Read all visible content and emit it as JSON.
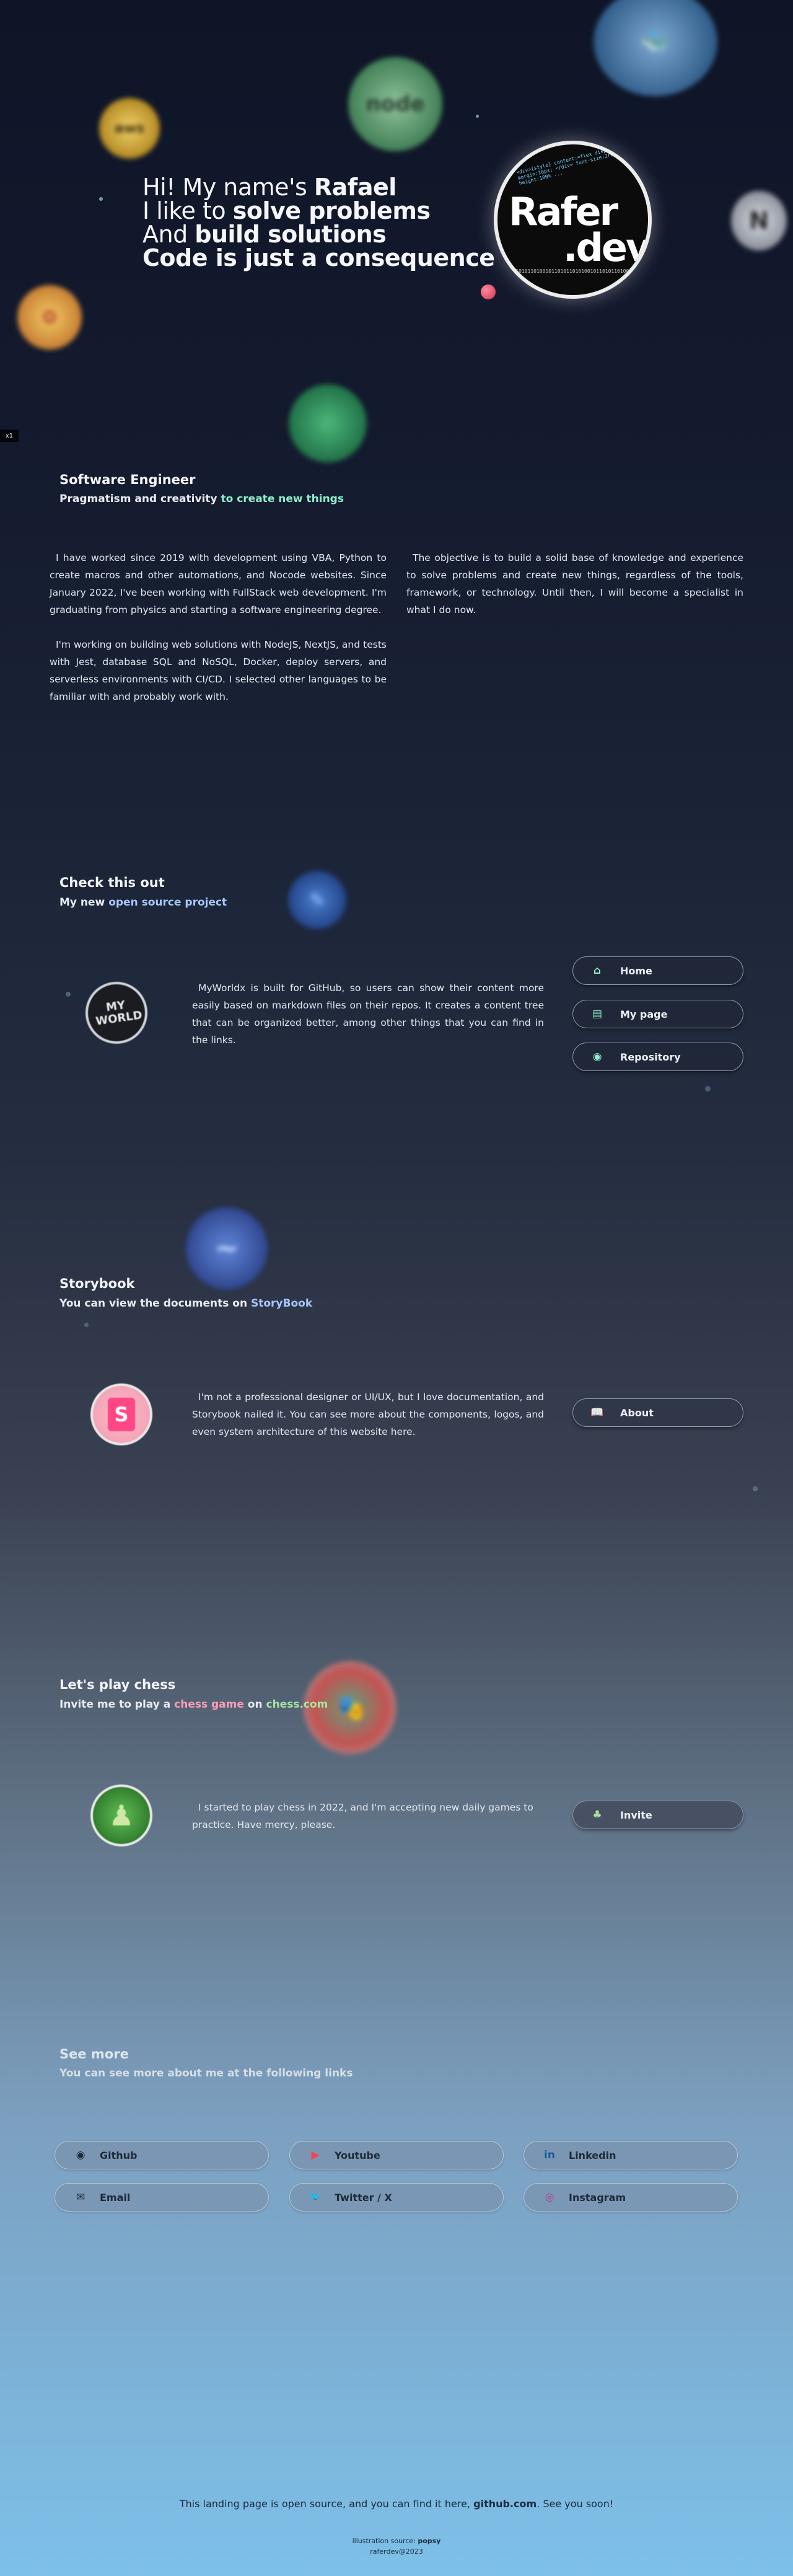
{
  "hero": {
    "line1_prefix": "Hi! My name's ",
    "line1_name": "Rafael",
    "line2_prefix": "I like to ",
    "line2_bold": "solve problems",
    "line3_prefix": "And ",
    "line3_bold": "build solutions",
    "line4": "Code is just a consequence",
    "logo_line1": "Rafer",
    "logo_line2": ".dev"
  },
  "float_icons": {
    "aws": "aws",
    "node": "node",
    "next": "N",
    "tailwind": "~",
    "pencil": "✎",
    "badge": "x1"
  },
  "about": {
    "title": "Software Engineer",
    "subtitle_prefix": "Pragmatism and creativity ",
    "subtitle_accent": "to create new things",
    "p1": "I have worked since 2019 with development using VBA, Python to create macros and other automations, and Nocode websites. Since January 2022, I've been working with FullStack web development. I'm graduating from physics and starting a software engineering degree.",
    "p2": "I'm working on building web solutions with NodeJS, NextJS, and tests with Jest, database SQL and NoSQL, Docker, deploy servers, and serverless environments with CI/CD. I selected other languages to be familiar with and probably work with.",
    "p3": "The objective is to build a solid base of knowledge and experience to solve problems and create new things, regardless of the tools, framework, or technology. Until then, I will become a specialist in what I do now."
  },
  "project": {
    "title": "Check this out",
    "subtitle_prefix": "My new ",
    "subtitle_accent": "open source project",
    "avatar_text": "MY WORLD",
    "text": "MyWorldx is built for GitHub, so users can show their content more easily based on markdown files on their repos. It creates a content tree that can be organized better, among other things that you can find in the links.",
    "buttons": [
      {
        "label": "Home",
        "icon": "home-icon"
      },
      {
        "label": "My page",
        "icon": "page-icon"
      },
      {
        "label": "Repository",
        "icon": "github-icon"
      }
    ]
  },
  "storybook": {
    "title": "Storybook",
    "subtitle_prefix": "You can view the documents on ",
    "subtitle_accent": "StoryBook",
    "avatar_text": "S",
    "text": "I'm not a professional designer or UI/UX, but I love documentation, and Storybook nailed it. You can see more about the components, logos, and even system architecture of this website here.",
    "button": {
      "label": "About",
      "icon": "book-icon"
    }
  },
  "chess": {
    "title": "Let's play chess",
    "subtitle_prefix": "Invite me to play a ",
    "subtitle_accent1": "chess game",
    "subtitle_mid": " on ",
    "subtitle_accent2": "chess.com",
    "text": "I started to play chess in 2022, and I'm accepting new daily games to practice. Have mercy, please.",
    "button": {
      "label": "Invite",
      "icon": "tree-icon"
    }
  },
  "see_more": {
    "title": "See more",
    "subtitle": "You can see more about me at the following links",
    "links": [
      {
        "label": "Github",
        "icon": "github-icon"
      },
      {
        "label": "Youtube",
        "icon": "youtube-icon"
      },
      {
        "label": "Linkedin",
        "icon": "linkedin-icon"
      },
      {
        "label": "Email",
        "icon": "email-icon"
      },
      {
        "label": "Twitter / X",
        "icon": "twitter-icon"
      },
      {
        "label": "Instagram",
        "icon": "instagram-icon"
      }
    ]
  },
  "footer": {
    "prefix": "This landing page is open source, and you can find it here, ",
    "link": "github.com",
    "suffix": ". See you soon!",
    "illustration_prefix": "illustration source: ",
    "illustration_name": "popsy",
    "copyright": "raferdev@2023"
  },
  "colors": {
    "accent_green": "#8ff0c9",
    "accent_blue": "#a8c8ff",
    "accent_pink": "#ff9fb6"
  }
}
